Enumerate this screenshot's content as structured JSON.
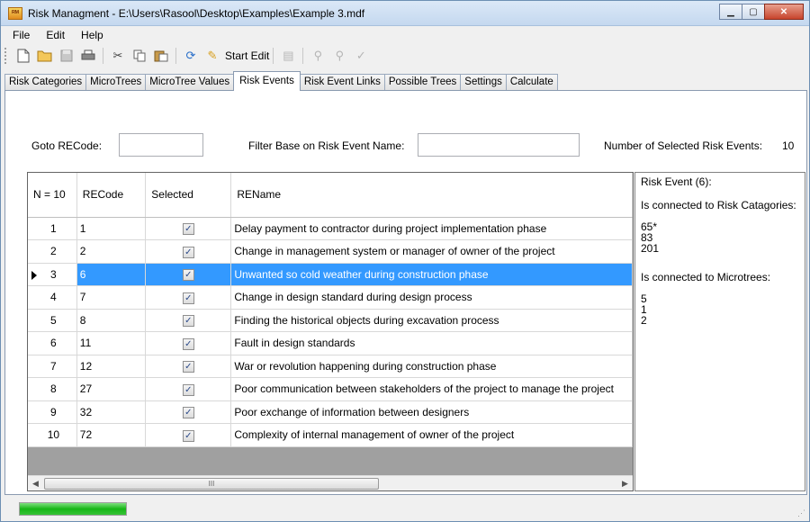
{
  "window": {
    "title": "Risk Managment - E:\\Users\\Rasool\\Desktop\\Examples\\Example 3.mdf",
    "app_icon_text": "ᴿᴹ"
  },
  "menu": [
    "File",
    "Edit",
    "Help"
  ],
  "toolbar": {
    "start_edit_label": "Start Edit",
    "icons": [
      "new-icon",
      "open-icon",
      "save-icon",
      "print-icon",
      "cut-icon",
      "copy-icon",
      "paste-icon",
      "refresh-icon",
      "pencil-icon",
      "delete-icon",
      "link-icon",
      "unlink-icon",
      "check-icon"
    ]
  },
  "tabs": [
    "Risk Categories",
    "MicroTrees",
    "MicroTree Values",
    "Risk Events",
    "Risk Event Links",
    "Possible Trees",
    "Settings",
    "Calculate"
  ],
  "active_tab": "Risk Events",
  "filters": {
    "goto_label": "Goto RECode:",
    "goto_value": "",
    "filter_label": "Filter Base on Risk Event Name:",
    "filter_value": "",
    "count_label": "Number of Selected Risk Events:",
    "count_value": "10"
  },
  "grid": {
    "columns": [
      "N = 10",
      "RECode",
      "Selected",
      "REName"
    ],
    "rows": [
      {
        "n": "1",
        "code": "1",
        "selected": true,
        "name": "Delay payment to contractor during project implementation phase"
      },
      {
        "n": "2",
        "code": "2",
        "selected": true,
        "name": "Change in management system or manager of owner of the project"
      },
      {
        "n": "3",
        "code": "6",
        "selected": true,
        "name": "Unwanted so cold weather during construction phase"
      },
      {
        "n": "4",
        "code": "7",
        "selected": true,
        "name": "Change in design standard during design process"
      },
      {
        "n": "5",
        "code": "8",
        "selected": true,
        "name": "Finding the historical objects during excavation process"
      },
      {
        "n": "6",
        "code": "11",
        "selected": true,
        "name": "Fault in design standards"
      },
      {
        "n": "7",
        "code": "12",
        "selected": true,
        "name": "War or revolution happening during construction phase"
      },
      {
        "n": "8",
        "code": "27",
        "selected": true,
        "name": "Poor communication between stakeholders of the project to manage the project"
      },
      {
        "n": "9",
        "code": "32",
        "selected": true,
        "name": "Poor exchange of information between designers"
      },
      {
        "n": "10",
        "code": "72",
        "selected": true,
        "name": "Complexity of internal management of owner of the project"
      }
    ],
    "selected_row_index": 2,
    "scroll_thumb_glyph": "III"
  },
  "detail": {
    "header": "Risk Event (6):",
    "categories_label": "Is connected to Risk Catagories:",
    "categories": [
      "65*",
      "83",
      "201"
    ],
    "microtrees_label": "Is connected to Microtrees:",
    "microtrees": [
      "5",
      "1",
      "2"
    ]
  },
  "status": {
    "progress_fraction": 1.0
  }
}
